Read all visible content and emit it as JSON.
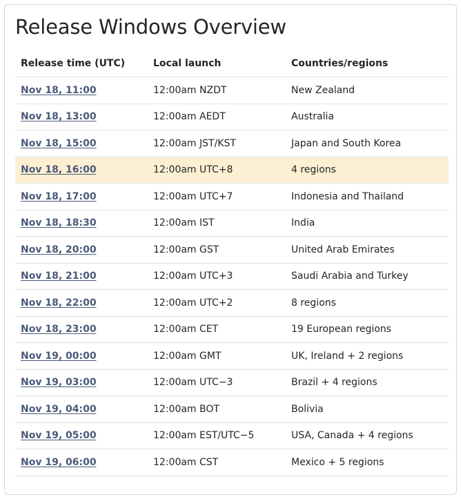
{
  "title": "Release Windows Overview",
  "columns": {
    "release_time": "Release time (UTC)",
    "local_launch": "Local launch",
    "regions": "Countries/regions"
  },
  "highlight_color": "#fdf0d2",
  "link_color": "#495a7a",
  "rows": [
    {
      "time": "Nov 18, 11:00",
      "local": "12:00am NZDT",
      "regions": "New Zealand",
      "highlighted": false
    },
    {
      "time": "Nov 18, 13:00",
      "local": "12:00am AEDT",
      "regions": "Australia",
      "highlighted": false
    },
    {
      "time": "Nov 18, 15:00",
      "local": "12:00am JST/KST",
      "regions": "Japan and South Korea",
      "highlighted": false
    },
    {
      "time": "Nov 18, 16:00",
      "local": "12:00am UTC+8",
      "regions": "4 regions",
      "highlighted": true
    },
    {
      "time": "Nov 18, 17:00",
      "local": "12:00am UTC+7",
      "regions": "Indonesia and Thailand",
      "highlighted": false
    },
    {
      "time": "Nov 18, 18:30",
      "local": "12:00am IST",
      "regions": "India",
      "highlighted": false
    },
    {
      "time": "Nov 18, 20:00",
      "local": "12:00am GST",
      "regions": "United Arab Emirates",
      "highlighted": false
    },
    {
      "time": "Nov 18, 21:00",
      "local": "12:00am UTC+3",
      "regions": "Saudi Arabia and Turkey",
      "highlighted": false
    },
    {
      "time": "Nov 18, 22:00",
      "local": "12:00am UTC+2",
      "regions": "8 regions",
      "highlighted": false
    },
    {
      "time": "Nov 18, 23:00",
      "local": "12:00am CET",
      "regions": "19 European regions",
      "highlighted": false
    },
    {
      "time": "Nov 19, 00:00",
      "local": "12:00am GMT",
      "regions": "UK, Ireland + 2 regions",
      "highlighted": false
    },
    {
      "time": "Nov 19, 03:00",
      "local": "12:00am UTC−3",
      "regions": "Brazil + 4 regions",
      "highlighted": false
    },
    {
      "time": "Nov 19, 04:00",
      "local": "12:00am BOT",
      "regions": "Bolivia",
      "highlighted": false
    },
    {
      "time": "Nov 19, 05:00",
      "local": "12:00am EST/UTC−5",
      "regions": "USA, Canada + 4 regions",
      "highlighted": false
    },
    {
      "time": "Nov 19, 06:00",
      "local": "12:00am CST",
      "regions": "Mexico + 5 regions",
      "highlighted": false
    }
  ]
}
